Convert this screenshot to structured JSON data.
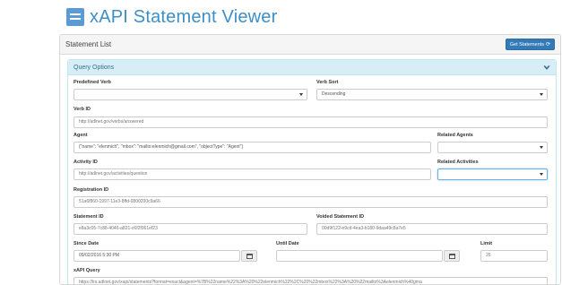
{
  "app": {
    "title": "xAPI Statement Viewer"
  },
  "statement_list": {
    "title": "Statement List",
    "get_button_label": "Get Statements",
    "get_button_glyph": "⟳"
  },
  "query_options": {
    "title": "Query Options",
    "predefined_verb": {
      "label": "Predefined Verb",
      "value": ""
    },
    "verb_sort": {
      "label": "Verb Sort",
      "value": "Descending"
    },
    "verb_id": {
      "label": "Verb ID",
      "placeholder": "http://adlnet.gov/verbs/answered"
    },
    "agent": {
      "label": "Agent",
      "value": "{\"name\": \"elenmich\", \"mbox\": \"mailto:elenmich@gmail.com\", \"objectType\": \"Agent\"}"
    },
    "related_agents": {
      "label": "Related Agents",
      "value": ""
    },
    "activity_id": {
      "label": "Activity ID",
      "placeholder": "http://adlnet.gov/activities/question"
    },
    "related_activities": {
      "label": "Related Activities",
      "value": ""
    },
    "registration_id": {
      "label": "Registration ID",
      "placeholder": "51a6f860-1997-11e3-8ffd-0800200c9a66"
    },
    "statement_id": {
      "label": "Statement ID",
      "placeholder": "e8a3c05-7c88-4046-a821-c6f2f061ef23"
    },
    "voided_statement_id": {
      "label": "Voided Statement ID",
      "placeholder": "00d9f122-e9cd-4ea3-b180-9daa49c8a7e5"
    },
    "since_date": {
      "label": "Since Date",
      "value": "09/02/2016 5:30 PM"
    },
    "until_date": {
      "label": "Until Date",
      "value": ""
    },
    "limit": {
      "label": "Limit",
      "value": "25"
    },
    "xapi_query": {
      "label": "xAPI Query",
      "value": "https://lrs.adlnet.gov/xapi/statements?format=exact&agent=%7B%22name%22%3A%20%22elenmich%22%2C%20%22mbox%22%3A%20%22mailto%3Aelenmich%40gma"
    }
  }
}
